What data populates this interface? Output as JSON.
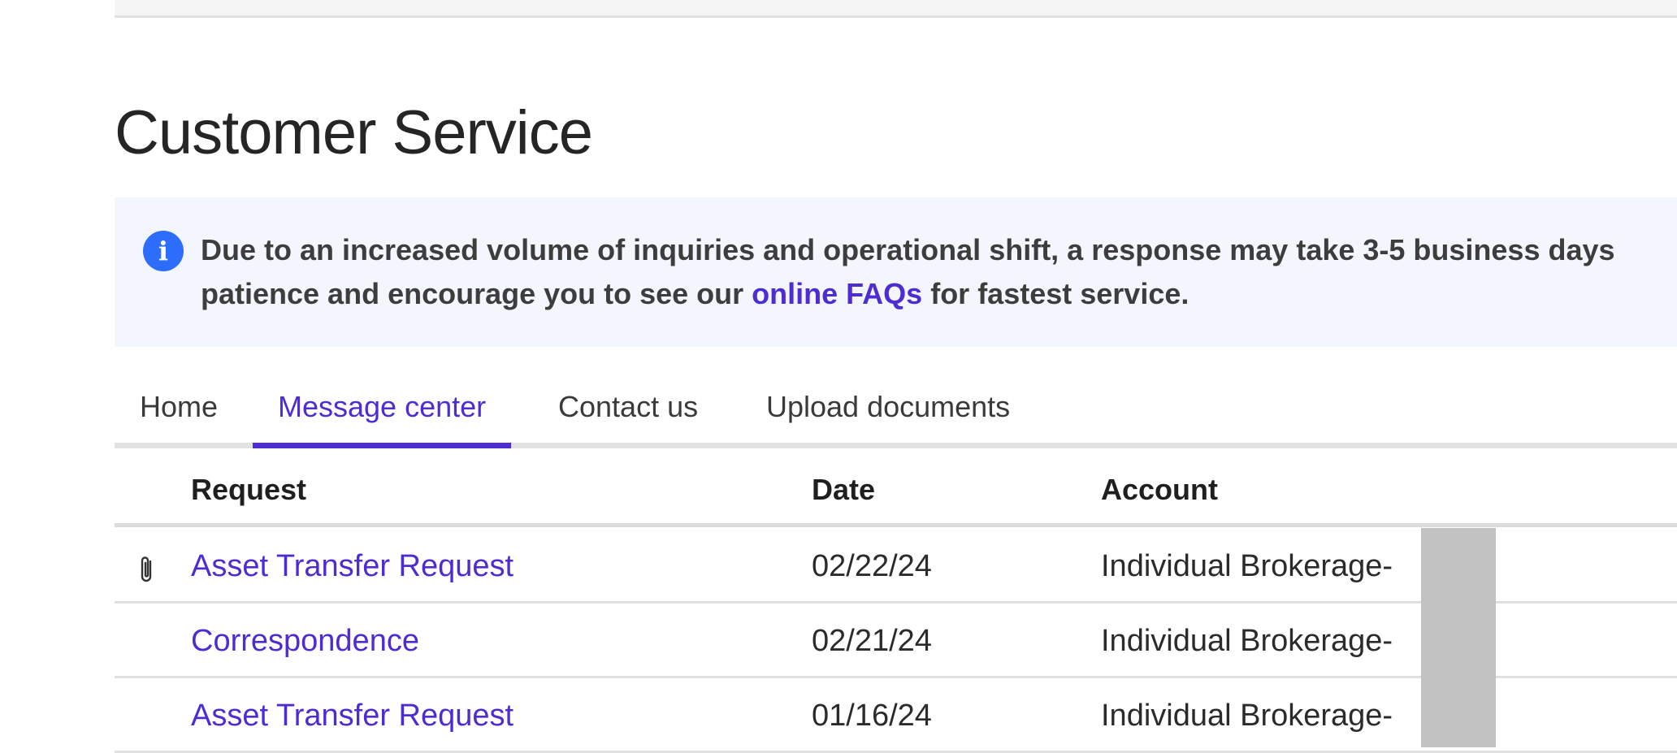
{
  "page": {
    "title": "Customer Service"
  },
  "alert": {
    "icon": "info-icon",
    "line1": "Due to an increased volume of inquiries and operational shift, a response may take 3-5 business days",
    "line2_before": "patience and encourage you to see our ",
    "link_text": "online FAQs",
    "line2_after": " for fastest service."
  },
  "tabs": [
    {
      "label": "Home"
    },
    {
      "label": "Message center",
      "active": true
    },
    {
      "label": "Contact us"
    },
    {
      "label": "Upload documents"
    }
  ],
  "table": {
    "columns": [
      "Request",
      "Date",
      "Account"
    ],
    "rows": [
      {
        "request": "Asset Transfer Request",
        "date": "02/22/24",
        "account": "Individual Brokerage-",
        "attachment": true
      },
      {
        "request": "Correspondence",
        "date": "02/21/24",
        "account": "Individual Brokerage-",
        "attachment": false
      },
      {
        "request": "Asset Transfer Request",
        "date": "01/16/24",
        "account": "Individual Brokerage-",
        "attachment": false
      }
    ]
  },
  "colors": {
    "accent": "#4d2cd1",
    "info_icon": "#2c6dfb",
    "alert_bg": "#f3f7fd"
  }
}
